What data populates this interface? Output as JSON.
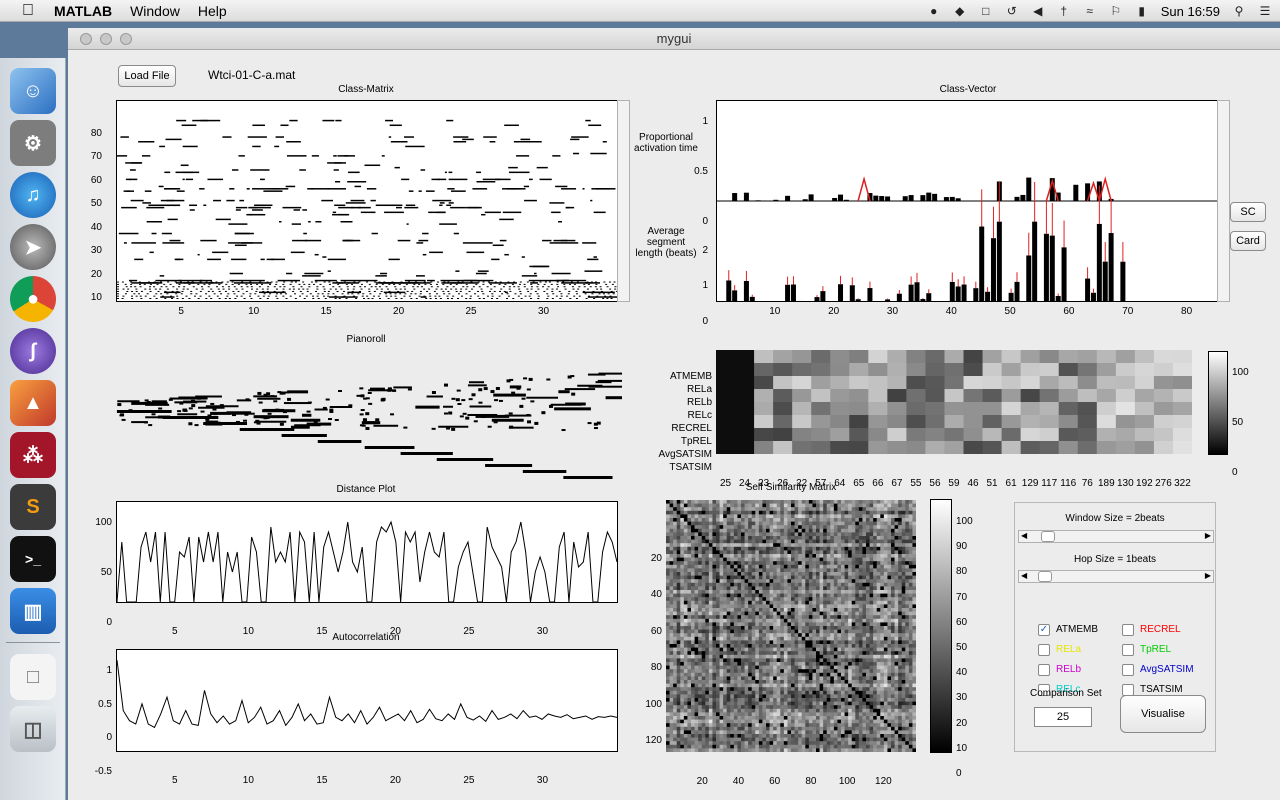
{
  "menubar": {
    "app": "MATLAB",
    "items": [
      "Window",
      "Help"
    ],
    "clock": "Sun 16:59"
  },
  "window": {
    "title": "mygui"
  },
  "toolbar": {
    "load_label": "Load File",
    "file_name": "Wtci-01-C-a.mat"
  },
  "class_matrix": {
    "title": "Class-Matrix",
    "yticks": [
      "80",
      "70",
      "60",
      "50",
      "40",
      "30",
      "20",
      "10"
    ],
    "xticks": [
      "5",
      "10",
      "15",
      "20",
      "25",
      "30"
    ]
  },
  "class_vector": {
    "title": "Class-Vector",
    "top_label": "Proportional activation time",
    "bottom_label": "Average segment length (beats)",
    "top_yticks": [
      "1",
      "0.5",
      "0"
    ],
    "bottom_yticks": [
      "2",
      "1",
      "0"
    ],
    "xticks": [
      "10",
      "20",
      "30",
      "40",
      "50",
      "60",
      "70",
      "80"
    ],
    "sc_label": "SC",
    "card_label": "Card"
  },
  "pianoroll": {
    "title": "Pianoroll"
  },
  "heatmap": {
    "rows": [
      "ATMEMB",
      "RELa",
      "RELb",
      "RELc",
      "RECREL",
      "TpREL",
      "AvgSATSIM",
      "TSATSIM"
    ],
    "cols": [
      "25",
      "24",
      "23",
      "26",
      "22",
      "57",
      "64",
      "65",
      "66",
      "67",
      "55",
      "56",
      "59",
      "46",
      "51",
      "61",
      "129",
      "117",
      "116",
      "76",
      "189",
      "130",
      "192",
      "276",
      "322"
    ],
    "cbar": [
      "100",
      "50",
      "0"
    ]
  },
  "distance": {
    "title": "Distance Plot",
    "yticks": [
      "100",
      "50",
      "0"
    ],
    "xticks": [
      "5",
      "10",
      "15",
      "20",
      "25",
      "30"
    ],
    "values": [
      0,
      60,
      0,
      0,
      0,
      55,
      70,
      40,
      70,
      0,
      70,
      0,
      0,
      50,
      45,
      65,
      0,
      65,
      40,
      70,
      40,
      70,
      0,
      50,
      30,
      50,
      0,
      0,
      65,
      50,
      0,
      0,
      75,
      40,
      50,
      40,
      70,
      0,
      70,
      60,
      0,
      70,
      0,
      55,
      70,
      50,
      30,
      50,
      80,
      40,
      30,
      55,
      0,
      0,
      60,
      75,
      70,
      80,
      60,
      0,
      70,
      60,
      70,
      20,
      50,
      70,
      50,
      45,
      70,
      0,
      0,
      35,
      50,
      60,
      30,
      0,
      0,
      75,
      55,
      45,
      35,
      0,
      50,
      60,
      80,
      50,
      0,
      30,
      45,
      30,
      0,
      0,
      55,
      70,
      0,
      60,
      35,
      40,
      70,
      0,
      0,
      50,
      70,
      60,
      40
    ]
  },
  "autocorr": {
    "title": "Autocorrelation",
    "yticks": [
      "1",
      "0.5",
      "0",
      "-0.5"
    ],
    "xticks": [
      "5",
      "10",
      "15",
      "20",
      "25",
      "30"
    ],
    "values": [
      0.85,
      0.1,
      -0.05,
      -0.1,
      0.2,
      -0.1,
      -0.15,
      0.05,
      0.3,
      -0.05,
      -0.1,
      0.1,
      -0.1,
      -0.12,
      0.4,
      0.05,
      -0.08,
      0.02,
      -0.1,
      -0.05,
      0.25,
      -0.08,
      0.0,
      0.15,
      -0.1,
      -0.05,
      0.1,
      -0.12,
      0.0,
      0.2,
      -0.05,
      0.05,
      -0.1,
      -0.08,
      0.3,
      0.0,
      -0.05,
      0.05,
      -0.08,
      0.1,
      -0.1,
      0.0,
      0.15,
      -0.05,
      0.0,
      0.05,
      -0.05,
      0.1,
      -0.08,
      -0.03,
      0.12,
      -0.02,
      -0.05,
      0.05,
      -0.03,
      0.2,
      0.0,
      -0.04,
      0.02,
      -0.06,
      0.1,
      -0.03,
      0.0,
      0.05,
      -0.02,
      0.1,
      0.0,
      0.02,
      -0.03,
      0.05,
      0.02,
      0.0,
      0.04,
      -0.02,
      0.0,
      0.02,
      -0.03,
      0.01,
      0.0,
      0.02,
      0.0
    ]
  },
  "ssm": {
    "title": "Self Similarity Matrix",
    "yticks": [
      "20",
      "40",
      "60",
      "80",
      "100",
      "120"
    ],
    "xticks": [
      "20",
      "40",
      "60",
      "80",
      "100",
      "120"
    ],
    "cbar": [
      "100",
      "90",
      "80",
      "70",
      "60",
      "50",
      "40",
      "30",
      "20",
      "10",
      "0"
    ]
  },
  "controls": {
    "window_label": "Window Size = 2beats",
    "hop_label": "Hop Size = 1beats",
    "window_fraction": 0.05,
    "hop_fraction": 0.03,
    "checkboxes": [
      {
        "label": "ATMEMB",
        "color": "#000000",
        "checked": true
      },
      {
        "label": "RECREL",
        "color": "#ff0000",
        "checked": false
      },
      {
        "label": "RELa",
        "color": "#e6e600",
        "checked": false
      },
      {
        "label": "TpREL",
        "color": "#00cc00",
        "checked": false
      },
      {
        "label": "RELb",
        "color": "#cc00cc",
        "checked": false
      },
      {
        "label": "AvgSATSIM",
        "color": "#0000cc",
        "checked": false
      },
      {
        "label": "RELc",
        "color": "#00cccc",
        "checked": false
      },
      {
        "label": "TSATSIM",
        "color": "#000000",
        "checked": false
      }
    ],
    "comparison_label": "Comparison Set",
    "comparison_value": "25",
    "visualise_label": "Visualise"
  }
}
